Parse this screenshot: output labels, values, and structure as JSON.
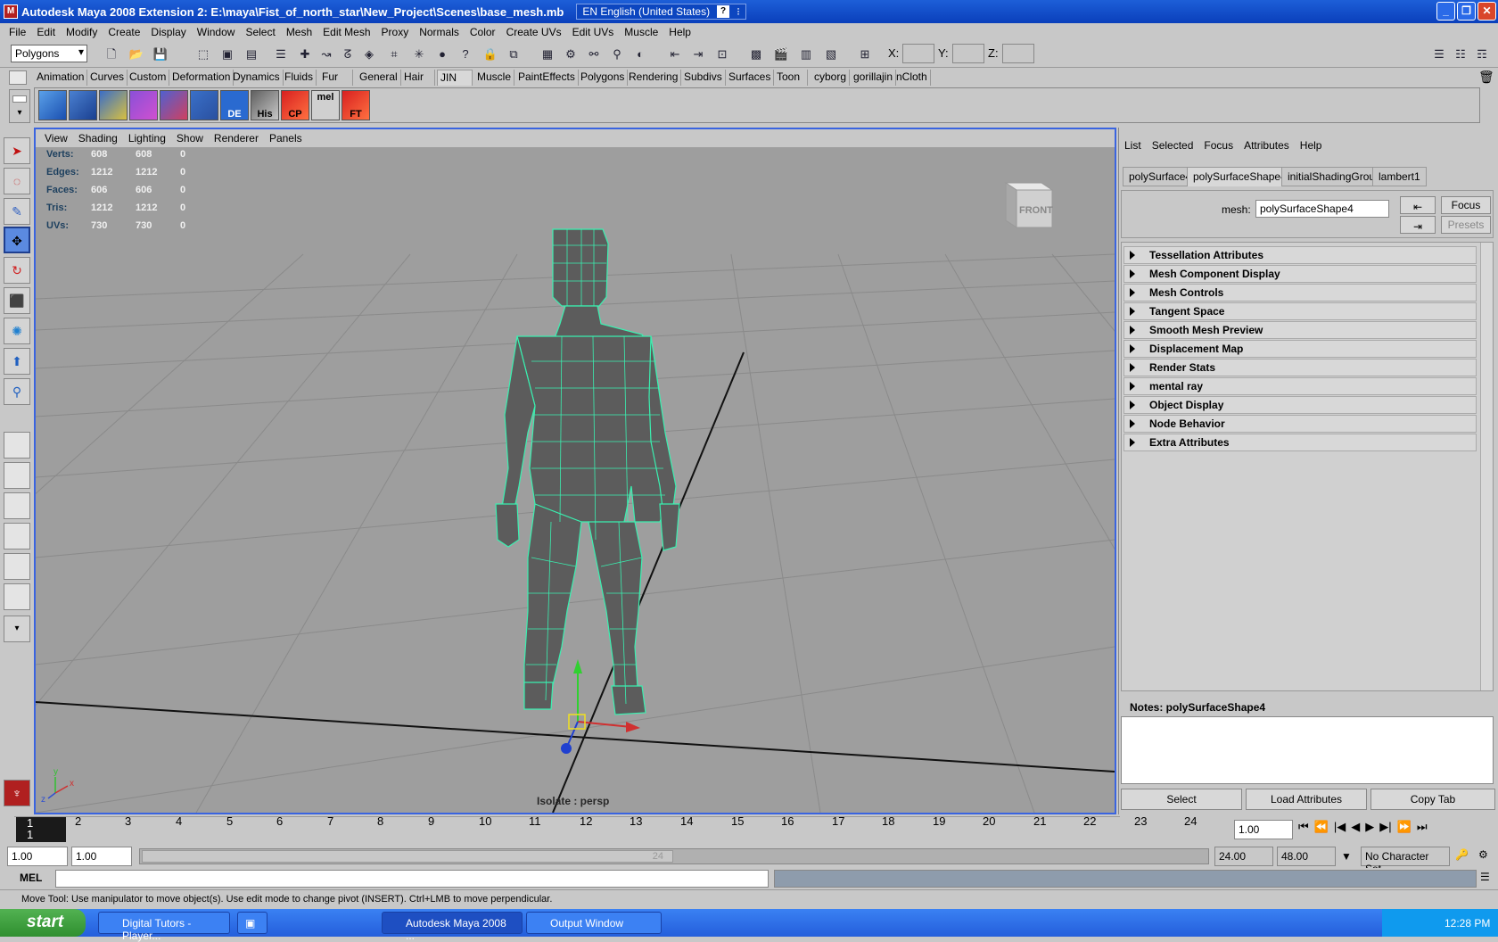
{
  "window": {
    "title": "Autodesk Maya 2008 Extension 2: E:\\maya\\Fist_of_north_star\\New_Project\\Scenes\\base_mesh.mb",
    "language": "EN English (United States)"
  },
  "menubar": [
    "File",
    "Edit",
    "Modify",
    "Create",
    "Display",
    "Window",
    "Select",
    "Mesh",
    "Edit Mesh",
    "Proxy",
    "Normals",
    "Color",
    "Create UVs",
    "Edit UVs",
    "Muscle",
    "Help"
  ],
  "statusline": {
    "mode": "Polygons",
    "x_label": "X:",
    "y_label": "Y:",
    "z_label": "Z:"
  },
  "shelf_tabs": [
    "Animation",
    "Curves",
    "Custom",
    "Deformation",
    "Dynamics",
    "Fluids",
    "Fur",
    "General",
    "Hair",
    "JIN",
    "Muscle",
    "PaintEffects",
    "Polygons",
    "Rendering",
    "Subdivs",
    "Surfaces",
    "Toon",
    "cyborg",
    "gorillajin",
    "nCloth"
  ],
  "shelf_icons": [
    "",
    "",
    "",
    "",
    "",
    "",
    "",
    "DE",
    "His",
    "CP",
    "mel",
    "FT"
  ],
  "viewport": {
    "menu": [
      "View",
      "Shading",
      "Lighting",
      "Show",
      "Renderer",
      "Panels"
    ],
    "viewcube": "FRONT",
    "isolate": "Isolate : persp",
    "hud": [
      {
        "label": "Verts:",
        "a": "608",
        "b": "608",
        "c": "0"
      },
      {
        "label": "Edges:",
        "a": "1212",
        "b": "1212",
        "c": "0"
      },
      {
        "label": "Faces:",
        "a": "606",
        "b": "606",
        "c": "0"
      },
      {
        "label": "Tris:",
        "a": "1212",
        "b": "1212",
        "c": "0"
      },
      {
        "label": "UVs:",
        "a": "730",
        "b": "730",
        "c": "0"
      }
    ]
  },
  "attr_editor": {
    "menu": [
      "List",
      "Selected",
      "Focus",
      "Attributes",
      "Help"
    ],
    "tabs": [
      "polySurface4",
      "polySurfaceShape4",
      "initialShadingGroup",
      "lambert1"
    ],
    "mesh_label": "mesh:",
    "mesh_value": "polySurfaceShape4",
    "focus": "Focus",
    "presets": "Presets",
    "sections": [
      "Tessellation Attributes",
      "Mesh Component Display",
      "Mesh Controls",
      "Tangent Space",
      "Smooth Mesh Preview",
      "Displacement Map",
      "Render Stats",
      "mental ray",
      "Object Display",
      "Node Behavior",
      "Extra Attributes"
    ],
    "notes_label": "Notes:  polySurfaceShape4",
    "buttons": [
      "Select",
      "Load Attributes",
      "Copy Tab"
    ]
  },
  "timeline": {
    "ticks": [
      "1",
      "2",
      "3",
      "4",
      "5",
      "6",
      "7",
      "8",
      "9",
      "10",
      "11",
      "12",
      "13",
      "14",
      "15",
      "16",
      "17",
      "18",
      "19",
      "20",
      "21",
      "22",
      "23",
      "24"
    ],
    "current_frame": "1.00",
    "range": {
      "start": "1.00",
      "start2": "1.00",
      "end": "24.00",
      "end2": "48.00",
      "slider_end": "24"
    },
    "character_set": "No Character Set"
  },
  "mel_label": "MEL",
  "help_line": "Move Tool: Use manipulator to move object(s). Use edit mode to change pivot (INSERT).  Ctrl+LMB to move perpendicular.",
  "taskbar": {
    "start": "start",
    "tasks": [
      "Digital Tutors - Player...",
      "",
      "Autodesk Maya 2008 ...",
      "Output Window"
    ],
    "time": "12:28 PM"
  }
}
